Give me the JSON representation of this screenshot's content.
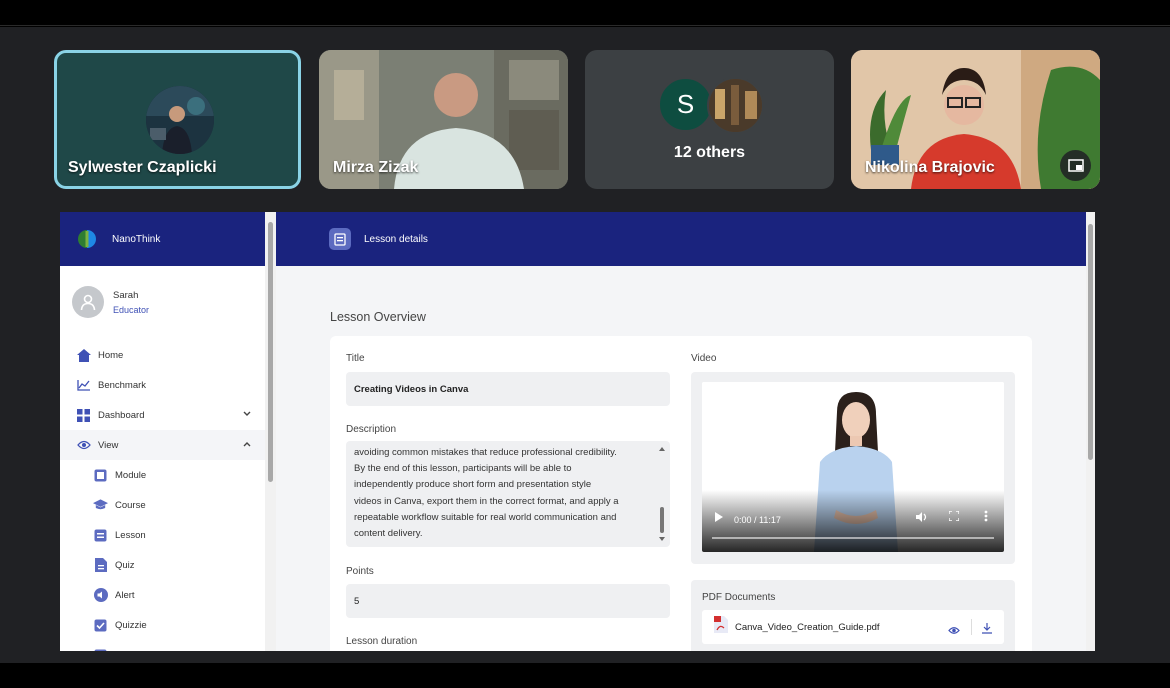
{
  "participants": {
    "tile_1_name": "Sylwester Czaplicki",
    "tile_2_name": "Mirza Zizak",
    "others_initial": "S",
    "others_label": "12 others",
    "tile_4_name": "Nikolina Brajovic"
  },
  "app": {
    "brand": "NanoThink",
    "page_title": "Lesson details"
  },
  "user": {
    "name": "Sarah",
    "role": "Educator"
  },
  "nav": {
    "home": "Home",
    "benchmark": "Benchmark",
    "dashboard": "Dashboard",
    "view": "View",
    "module": "Module",
    "course": "Course",
    "lesson": "Lesson",
    "quiz": "Quiz",
    "alert": "Alert",
    "quizzie": "Quizzie"
  },
  "lesson": {
    "section_title": "Lesson Overview",
    "title_label": "Title",
    "title_value": "Creating Videos in Canva",
    "description_label": "Description",
    "description_lines": [
      "avoiding common mistakes that reduce professional credibility.",
      "By the end of this lesson, participants will be able to",
      "independently produce short form and presentation style",
      "videos in Canva, export them in the correct format, and apply a",
      "repeatable workflow suitable for real world communication and",
      "content delivery."
    ],
    "points_label": "Points",
    "points_value": "5",
    "duration_label": "Lesson duration",
    "video_label": "Video",
    "video_time": "0:00 / 11:17",
    "pdf_label": "PDF Documents",
    "pdf_file": "Canva_Video_Creation_Guide.pdf"
  },
  "colors": {
    "header": "#1a237e",
    "accent": "#3f51b5",
    "active_speaker_border": "#8ad3e6"
  }
}
